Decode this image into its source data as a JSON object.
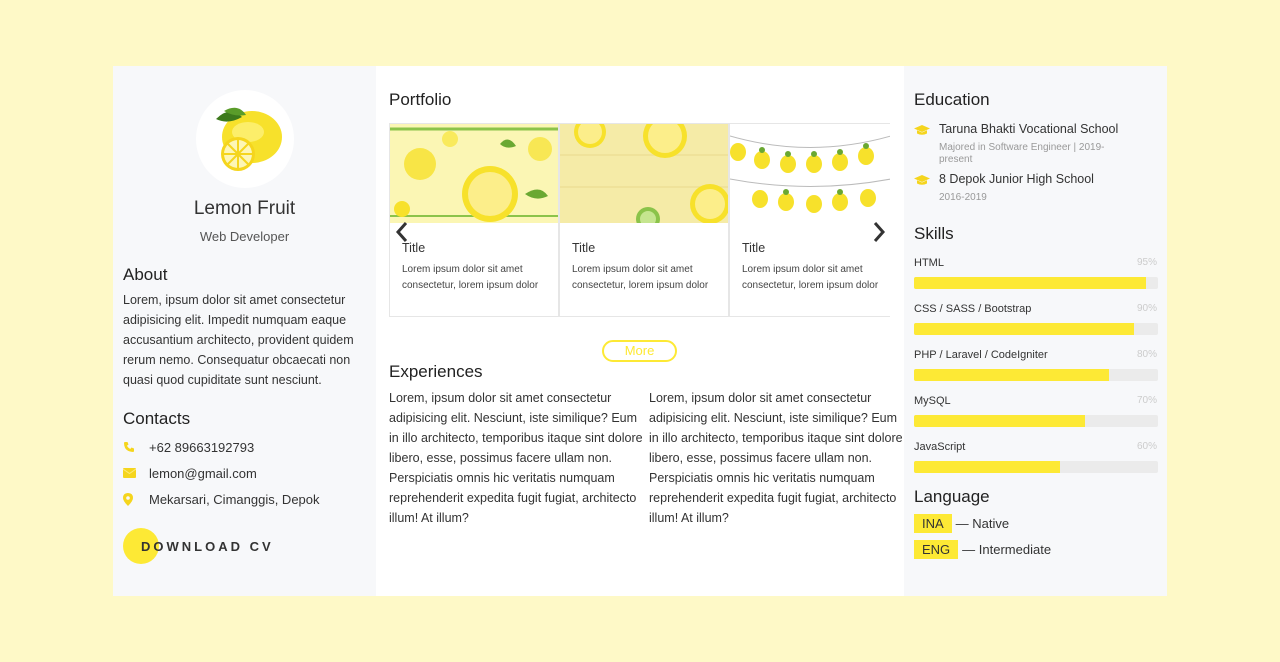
{
  "profile": {
    "name": "Lemon Fruit",
    "role": "Web Developer",
    "avatar_icon": "lemon-icon"
  },
  "about": {
    "title": "About",
    "text": "Lorem, ipsum dolor sit amet consectetur adipisicing elit. Impedit numquam eaque accusantium architecto, provident quidem rerum nemo. Consequatur obcaecati non quasi quod cupiditate sunt nesciunt."
  },
  "contacts": {
    "title": "Contacts",
    "items": [
      {
        "icon": "phone-icon",
        "text": "+62 89663192793"
      },
      {
        "icon": "mail-icon",
        "text": "lemon@gmail.com"
      },
      {
        "icon": "location-pin-icon",
        "text": "Mekarsari, Cimanggis, Depok"
      }
    ],
    "download_label": "DOWNLOAD CV"
  },
  "portfolio": {
    "title": "Portfolio",
    "items": [
      {
        "title": "Title",
        "text": "Lorem ipsum dolor sit amet consectetur, lorem ipsum dolor"
      },
      {
        "title": "Title",
        "text": "Lorem ipsum dolor sit amet consectetur, lorem ipsum dolor"
      },
      {
        "title": "Title",
        "text": "Lorem ipsum dolor sit amet consectetur, lorem ipsum dolor"
      }
    ],
    "more_label": "More"
  },
  "experiences": {
    "title": "Experiences",
    "columns": [
      "Lorem, ipsum dolor sit amet consectetur adipisicing elit. Nesciunt, iste similique? Eum in illo architecto, temporibus itaque sint dolore libero, esse, possimus facere ullam non. Perspiciatis omnis hic veritatis numquam reprehenderit expedita fugit fugiat, architecto illum! At illum?",
      "Lorem, ipsum dolor sit amet consectetur adipisicing elit. Nesciunt, iste similique? Eum in illo architecto, temporibus itaque sint dolore libero, esse, possimus facere ullam non. Perspiciatis omnis hic veritatis numquam reprehenderit expedita fugit fugiat, architecto illum! At illum?"
    ]
  },
  "education": {
    "title": "Education",
    "items": [
      {
        "icon": "graduation-cap-icon",
        "name": "Taruna Bhakti Vocational School",
        "sub": "Majored in Software Engineer | 2019-present"
      },
      {
        "icon": "graduation-cap-icon",
        "name": "8 Depok Junior High School",
        "sub": "2016-2019"
      }
    ]
  },
  "skills": {
    "title": "Skills",
    "items": [
      {
        "name": "HTML",
        "pct_label": "95%",
        "level": 0.95
      },
      {
        "name": "CSS / SASS / Bootstrap",
        "pct_label": "90%",
        "level": 0.9
      },
      {
        "name": "PHP / Laravel / CodeIgniter",
        "pct_label": "80%",
        "level": 0.8
      },
      {
        "name": "MySQL",
        "pct_label": "70%",
        "level": 0.7
      },
      {
        "name": "JavaScript",
        "pct_label": "60%",
        "level": 0.6
      }
    ]
  },
  "language": {
    "title": "Language",
    "items": [
      {
        "code": "INA",
        "level": "— Native"
      },
      {
        "code": "ENG",
        "level": "— Intermediate"
      }
    ]
  },
  "colors": {
    "page_bg": "#fef9c7",
    "accent": "#fde935",
    "panel_bg": "#f7f8fa"
  }
}
